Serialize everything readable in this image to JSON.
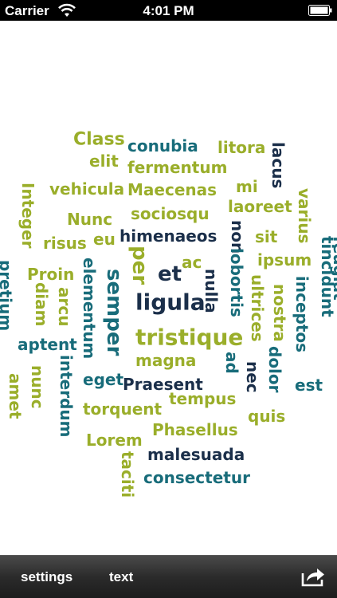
{
  "status_bar": {
    "carrier": "Carrier",
    "time": "4:01 PM"
  },
  "toolbar": {
    "settings_label": "settings",
    "text_label": "text",
    "share_icon": "share-icon"
  },
  "colors": {
    "green": "#9aae2a",
    "teal": "#186c7a",
    "navy": "#1b2f4a"
  },
  "words": [
    {
      "text": "Class",
      "color": "green"
    },
    {
      "text": "conubia",
      "color": "teal"
    },
    {
      "text": "litora",
      "color": "green"
    },
    {
      "text": "lacus",
      "color": "navy"
    },
    {
      "text": "elit",
      "color": "green"
    },
    {
      "text": "fermentum",
      "color": "green"
    },
    {
      "text": "vehicula",
      "color": "green"
    },
    {
      "text": "Maecenas",
      "color": "green"
    },
    {
      "text": "mi",
      "color": "green"
    },
    {
      "text": "Integer",
      "color": "green"
    },
    {
      "text": "varius",
      "color": "green"
    },
    {
      "text": "Nunc",
      "color": "green"
    },
    {
      "text": "sociosqu",
      "color": "green"
    },
    {
      "text": "laoreet",
      "color": "green"
    },
    {
      "text": "risus",
      "color": "green"
    },
    {
      "text": "eu",
      "color": "green"
    },
    {
      "text": "himenaeos",
      "color": "navy"
    },
    {
      "text": "non",
      "color": "navy"
    },
    {
      "text": "sit",
      "color": "green"
    },
    {
      "text": "tincidunt",
      "color": "teal"
    },
    {
      "text": "feugiat",
      "color": "teal"
    },
    {
      "text": "per",
      "color": "green"
    },
    {
      "text": "lobortis",
      "color": "teal"
    },
    {
      "text": "ipsum",
      "color": "green"
    },
    {
      "text": "ac",
      "color": "green"
    },
    {
      "text": "Proin",
      "color": "green"
    },
    {
      "text": "elementum",
      "color": "teal"
    },
    {
      "text": "semper",
      "color": "teal"
    },
    {
      "text": "et",
      "color": "navy"
    },
    {
      "text": "nulla",
      "color": "navy"
    },
    {
      "text": "pretium",
      "color": "teal"
    },
    {
      "text": "diam",
      "color": "green"
    },
    {
      "text": "arcu",
      "color": "green"
    },
    {
      "text": "ligula",
      "color": "navy"
    },
    {
      "text": "ultrices",
      "color": "green"
    },
    {
      "text": "nostra",
      "color": "green"
    },
    {
      "text": "inceptos",
      "color": "teal"
    },
    {
      "text": "tristique",
      "color": "green"
    },
    {
      "text": "aptent",
      "color": "teal"
    },
    {
      "text": "magna",
      "color": "green"
    },
    {
      "text": "ad",
      "color": "teal"
    },
    {
      "text": "nec",
      "color": "navy"
    },
    {
      "text": "dolor",
      "color": "teal"
    },
    {
      "text": "interdum",
      "color": "teal"
    },
    {
      "text": "eget",
      "color": "teal"
    },
    {
      "text": "amet",
      "color": "green"
    },
    {
      "text": "nunc",
      "color": "green"
    },
    {
      "text": "Praesent",
      "color": "navy"
    },
    {
      "text": "est",
      "color": "teal"
    },
    {
      "text": "tempus",
      "color": "green"
    },
    {
      "text": "torquent",
      "color": "green"
    },
    {
      "text": "quis",
      "color": "green"
    },
    {
      "text": "Phasellus",
      "color": "green"
    },
    {
      "text": "Lorem",
      "color": "green"
    },
    {
      "text": "malesuada",
      "color": "navy"
    },
    {
      "text": "taciti",
      "color": "green"
    },
    {
      "text": "consectetur",
      "color": "teal"
    }
  ]
}
